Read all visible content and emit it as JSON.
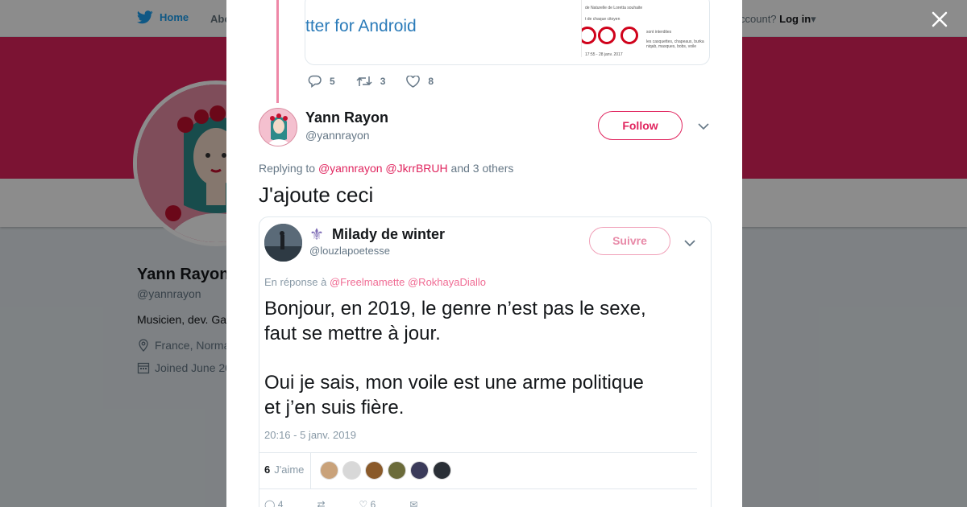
{
  "nav": {
    "home_label": "Home",
    "about_label": "Abo",
    "account_prompt": "ccount?",
    "login_label": "Log in"
  },
  "profile": {
    "name": "Yann Rayon",
    "handle": "@yannrayon",
    "bio": "Musicien, dev. Ga",
    "location": "France, Norma",
    "joined": "Joined June 20",
    "banner_color": "#e0245e"
  },
  "modal": {
    "prev_tweet": {
      "card_text": "tter for Android",
      "actions": {
        "replies": "5",
        "retweets": "3",
        "likes": "8"
      }
    },
    "tweet": {
      "author_name": "Yann Rayon",
      "author_handle": "@yannrayon",
      "follow_label": "Follow",
      "replying_prefix": "Replying to",
      "reply_mention_1": "@yannrayon",
      "reply_mention_2": "@JkrrBRUH",
      "reply_suffix": "and 3 others",
      "text": "J'ajoute ceci"
    },
    "embedded": {
      "name": "Milady de winter",
      "handle": "@louzlapoetesse",
      "follow_label": "Suivre",
      "reply_prefix": "En réponse à",
      "reply_mention_1": "@Freelmamette",
      "reply_mention_2": "@RokhayaDiallo",
      "line1": "Bonjour, en 2019, le genre n’est pas le sexe,",
      "line2": "faut se mettre à jour.",
      "line3": "Oui je sais, mon voile est une arme politique",
      "line4": "et j’en suis fière.",
      "date": "20:16 - 5 janv. 2019",
      "likes_count": "6",
      "likes_label": "J'aime",
      "bottom_replies": "4",
      "bottom_likes": "6"
    }
  },
  "colors": {
    "accent": "#e0245e",
    "link": "#1da1f2"
  }
}
